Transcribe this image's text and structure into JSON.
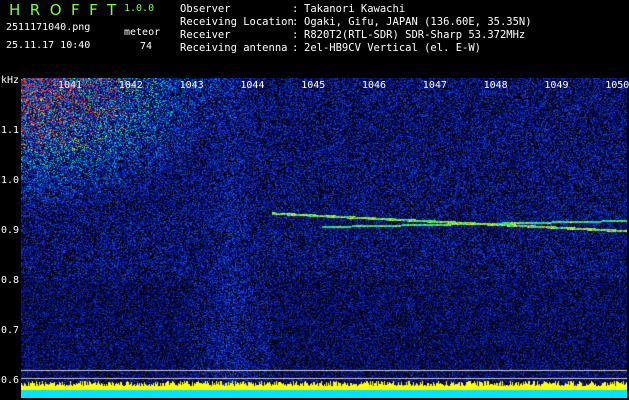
{
  "header": {
    "app_name": "HROFFT",
    "version": "1.0.0",
    "filename": "2511171040.png",
    "datetime": "25.11.17 10:40",
    "meteor_label": "meteor",
    "meteor_count": "74",
    "info": [
      {
        "key": "Observer",
        "value": "Takanori Kawachi"
      },
      {
        "key": "Receiving Location",
        "value": "Ogaki, Gifu, JAPAN (136.60E, 35.35N)"
      },
      {
        "key": "Receiver",
        "value": "R820T2(RTL-SDR) SDR-Sharp 53.372MHz"
      },
      {
        "key": "Receiving antenna",
        "value": "2el-HB9CV Vertical (el. E-W)"
      }
    ]
  },
  "colors": {
    "title_green": "#7cff4a",
    "text": "#ffffff",
    "background": "#000000",
    "baseline_yellow": "#ffff00",
    "baseline_cyan": "#00e5ff",
    "spectrum_blue": "#0a1e9c"
  },
  "chart_data": {
    "type": "heatmap",
    "y_unit": "kHz",
    "x_ticks": [
      "1041",
      "1042",
      "1043",
      "1044",
      "1045",
      "1046",
      "1047",
      "1048",
      "1049",
      "1050"
    ],
    "y_ticks": [
      "1.1",
      "1.0",
      "0.9",
      "0.8",
      "0.7",
      "0.6"
    ],
    "ylim": [
      0.58,
      1.2
    ]
  }
}
